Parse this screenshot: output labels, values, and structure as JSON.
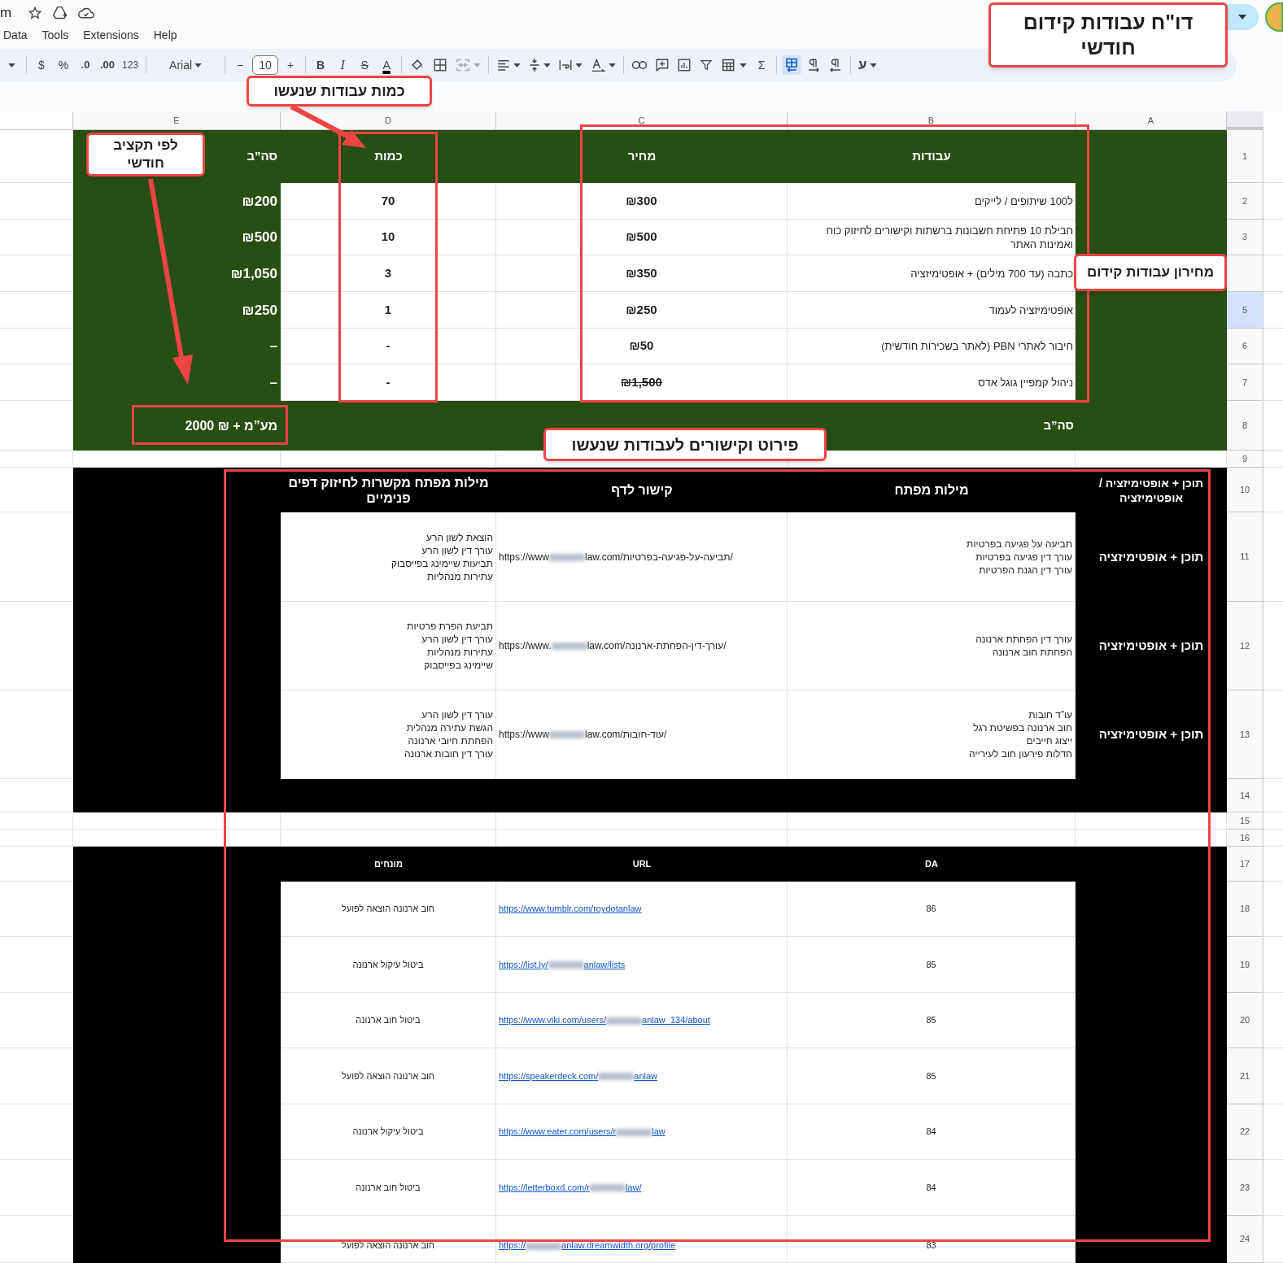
{
  "document": {
    "title_fragment": "m"
  },
  "menu": [
    "Help",
    "Extensions",
    "Tools",
    "Data"
  ],
  "toolbar": [
    [
      {
        "kind": "dropdown",
        "label": "ע",
        "selected": false,
        "disabled": false
      }
    ],
    [
      {
        "kind": "para-rtl",
        "selected": false,
        "disabled": false
      },
      {
        "kind": "para-ltr",
        "selected": false,
        "disabled": false
      },
      {
        "kind": "sheet-rtl",
        "selected": true,
        "disabled": false
      }
    ],
    [
      {
        "kind": "text",
        "label": "Σ",
        "selected": false,
        "disabled": false
      },
      {
        "kind": "table",
        "selected": false,
        "disabled": false
      },
      {
        "kind": "filter",
        "selected": false,
        "disabled": false
      },
      {
        "kind": "chart",
        "selected": false,
        "disabled": false
      },
      {
        "kind": "comment",
        "selected": false,
        "disabled": false
      },
      {
        "kind": "link",
        "selected": false,
        "disabled": false
      }
    ],
    [
      {
        "kind": "rotate",
        "selected": false,
        "disabled": false
      },
      {
        "kind": "wrap",
        "selected": false,
        "disabled": false
      },
      {
        "kind": "valign",
        "selected": false,
        "disabled": false
      },
      {
        "kind": "align",
        "selected": false,
        "disabled": false
      }
    ],
    [
      {
        "kind": "merge",
        "selected": false,
        "disabled": true
      },
      {
        "kind": "borders",
        "selected": false,
        "disabled": false
      },
      {
        "kind": "fill",
        "selected": false,
        "disabled": false
      }
    ],
    [
      {
        "kind": "color",
        "label": "A",
        "selected": false,
        "disabled": false
      },
      {
        "kind": "strike",
        "label": "S",
        "selected": false,
        "disabled": false
      },
      {
        "kind": "italic",
        "label": "I",
        "selected": false,
        "disabled": false
      },
      {
        "kind": "bold",
        "label": "B",
        "selected": false,
        "disabled": false
      }
    ],
    [
      {
        "kind": "text",
        "label": "+",
        "selected": false,
        "disabled": false
      },
      {
        "kind": "size",
        "label": "10",
        "selected": false,
        "disabled": false
      },
      {
        "kind": "text",
        "label": "−",
        "selected": false,
        "disabled": false
      }
    ],
    [
      {
        "kind": "font",
        "label": "Arial",
        "selected": false,
        "disabled": false
      }
    ],
    [
      {
        "kind": "small-text",
        "label": "123",
        "selected": false,
        "disabled": false
      },
      {
        "kind": "decimal-more",
        "label": ".00",
        "selected": false,
        "disabled": false
      },
      {
        "kind": "decimal-less",
        "label": ".0",
        "selected": false,
        "disabled": false
      },
      {
        "kind": "text",
        "label": "%",
        "selected": false,
        "disabled": false
      },
      {
        "kind": "text",
        "label": "$",
        "selected": false,
        "disabled": false
      }
    ],
    [
      {
        "kind": "caret",
        "selected": false,
        "disabled": false
      }
    ]
  ],
  "column_headers": [
    "A",
    "B",
    "C",
    "D",
    "E"
  ],
  "row_numbers": [
    {
      "label": "1",
      "selected": false
    },
    {
      "label": "2",
      "selected": false
    },
    {
      "label": "3",
      "selected": false
    },
    {
      "selected": false
    },
    {
      "label": "5",
      "selected": true
    },
    {
      "label": "6",
      "selected": false
    },
    {
      "label": "7",
      "selected": false
    },
    {
      "label": "8",
      "selected": false
    },
    {
      "label": "9",
      "selected": false
    },
    {
      "label": "10",
      "selected": false
    },
    {
      "label": "11",
      "selected": false
    },
    {
      "label": "12",
      "selected": false
    },
    {
      "label": "13",
      "selected": false
    },
    {
      "label": "14",
      "selected": false
    },
    {
      "label": "15",
      "selected": false
    },
    {
      "label": "16",
      "selected": false
    },
    {
      "label": "17",
      "selected": false
    },
    {
      "label": "18",
      "selected": false
    },
    {
      "label": "19",
      "selected": false
    },
    {
      "label": "20",
      "selected": false
    },
    {
      "label": "21",
      "selected": false
    },
    {
      "label": "22",
      "selected": false
    },
    {
      "label": "23",
      "selected": false
    },
    {
      "label": "24",
      "selected": false
    }
  ],
  "pricing": {
    "headers": {
      "total": "סה”ב",
      "quantity": "כמות",
      "price": "מחיר",
      "service": "עבודות"
    },
    "rows": [
      {
        "service": "ל100 שיתופים / לייקים",
        "price": "₪300",
        "price_struck": false,
        "quantity": "70",
        "total": "₪200"
      },
      {
        "service": "חבילת 10 פתיחת חשבונות ברשתות וקישורים לחיזוק כוח ואמינות האתר",
        "price": "₪500",
        "price_struck": false,
        "quantity": "10",
        "total": "₪500"
      },
      {
        "service": "כתבה (עד 700 מילים) + אופטימיזציה",
        "price": "₪350",
        "price_struck": false,
        "quantity": "3",
        "total": "₪1,050"
      },
      {
        "service": "אופטימיזציה לעמוד",
        "price": "₪250",
        "price_struck": false,
        "quantity": "1",
        "total": "₪250"
      },
      {
        "service": "חיבור לאתרי PBN (לאתר בשכירות חודשית)",
        "price": "₪50",
        "price_struck": false,
        "quantity": "-",
        "total": "–"
      },
      {
        "service": "ניהול קמפיין גוגל אדס",
        "price": "₪1,500",
        "price_struck": true,
        "quantity": "-",
        "total": "–"
      }
    ],
    "footer": {
      "label": "סה”ב",
      "total": "מע”מ + ₪ 2000"
    }
  },
  "keywords": {
    "headers": {
      "type": "תוכן + אופטימיזציה / אופטימיזציה",
      "keywords": "מילות מפתח",
      "page_link": "קישור לדף",
      "internal_keywords": "מילות מפתח מקשרות לחיזוק דפים פנימיים"
    },
    "rows": [
      {
        "type": "תוכן + אופטימיזציה",
        "keywords": "תביעה על פגיעה בפרטיות\nעורך דין פגיעה בפרטיות\nעורך דין הגנת הפרטיות",
        "url_start": "https://www",
        "url_end": "law.com/תביעה-על-פגיעה-בפרטיות/",
        "internal_keywords": "הוצאת לשון הרע\nעורך דין לשון הרע\nתביעות שיימינג בפייסבוק\nעתירות מנהליות"
      },
      {
        "type": "תוכן + אופטימיזציה",
        "keywords": "עורך דין הפחתת ארנונה\nהפחתת חוב ארנונה",
        "url_start": "https://www.",
        "url_end": "law.com/עורך-דין-הפחתת-ארנונה/",
        "internal_keywords": "תביעת הפרת פרטיות\nעורך דין לשון הרע\nעתירות מנהליות\nשיימינג בפייסבוק"
      },
      {
        "type": "תוכן + אופטימיזציה",
        "keywords": "עו”ד חובות\nחוב ארנונה בפשיטת רגל\nייצוג חייבים\nחדלות פירעון חוב לעירייה",
        "url_start": "https://www",
        "url_end": "law.com/עוד-חובות/",
        "internal_keywords": "עורך דין לשון הרע\nהגשת עתירה מנהלית\nהפחתת חיובי ארנונה\nעורך דין חובות ארנונה"
      }
    ]
  },
  "links": {
    "headers": {
      "da": "DA",
      "url": "URL",
      "terms": "מונחים"
    },
    "rows": [
      {
        "da": "86",
        "url_start": "https://www.tumblr.com/roydotanlaw",
        "terms": "חוב ארנונה הוצאה לפועל"
      },
      {
        "da": "85",
        "url_start": "https://list.ly/",
        "url_end": "anlaw/lists",
        "terms": "ביטול עיקול ארנונה"
      },
      {
        "da": "85",
        "url_start": "https://www.viki.com/users/",
        "url_end": "anlaw_134/about",
        "terms": "ביטול חוב ארנונה"
      },
      {
        "da": "85",
        "url_start": "https://speakerdeck.com/",
        "url_end": "anlaw",
        "terms": "חוב ארנונה הוצאה לפועל"
      },
      {
        "da": "84",
        "url_start": "https://www.eater.com/users/r",
        "url_end": "law",
        "terms": "ביטול עיקול ארנונה"
      },
      {
        "da": "84",
        "url_start": "https://letterboxd.com/r",
        "url_end": "law/",
        "terms": "ביטול חוב ארנונה"
      },
      {
        "da": "83",
        "url_start": "https://",
        "url_end": "anlaw.dreamwidth.org/profile",
        "terms": "חוב ארנונה הוצאה לפועל"
      }
    ]
  },
  "annotations": [
    "דו\"ח עבודות קידום חודשי",
    "כמות עבודות שנעשו",
    "לפי תקציב חודשי",
    "מחירון עבודות קידום",
    "פירוט וקישורים לעבודות שנעשו"
  ]
}
